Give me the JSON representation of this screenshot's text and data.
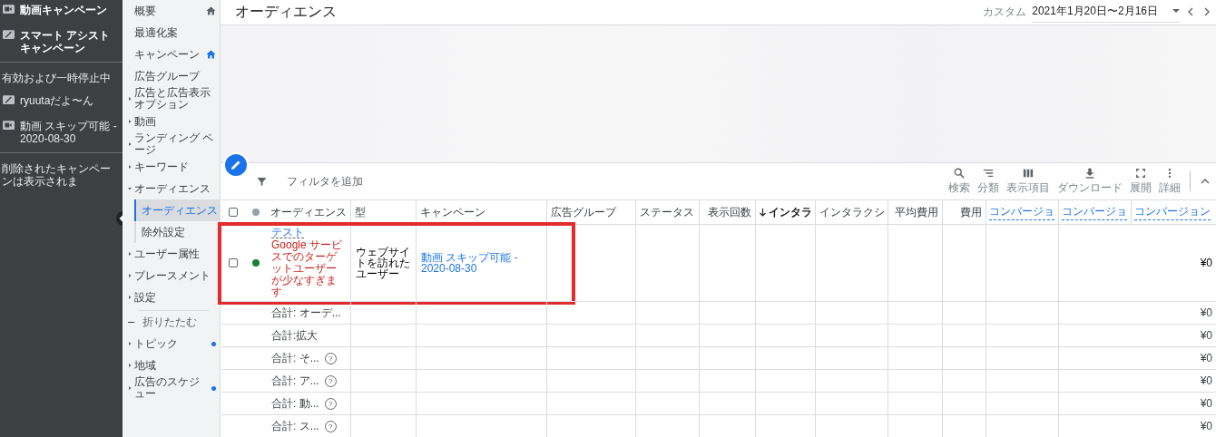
{
  "campaign_panel": {
    "campaigns": [
      {
        "kind": "video",
        "name": "動画キャンペーン"
      },
      {
        "kind": "smart",
        "name": "スマート アシストキャンペーン"
      }
    ],
    "section_label": "有効および一時停止中",
    "active_campaigns": [
      {
        "kind": "smart",
        "name": "ryuutaだよ〜ん"
      },
      {
        "kind": "video",
        "name": "動画 スキップ可能 - 2020-08-30"
      }
    ],
    "deleted_note": "削除されたキャンペーンは表示されま"
  },
  "nav": {
    "items": [
      {
        "kind": "link",
        "label": "概要",
        "selected": false,
        "home": true,
        "home_active": false
      },
      {
        "kind": "link",
        "label": "最適化案",
        "selected": false
      },
      {
        "kind": "link",
        "label": "キャンペーン",
        "selected": false,
        "home": true,
        "home_active": true
      },
      {
        "kind": "link",
        "label": "広告グループ",
        "selected": false
      },
      {
        "kind": "expandable",
        "label": "広告と広告表示オプション",
        "selected": false,
        "expanded": false
      },
      {
        "kind": "expandable",
        "label": "動画",
        "selected": false,
        "expanded": false
      },
      {
        "kind": "expandable",
        "label": "ランディング ページ",
        "selected": false,
        "expanded": false
      },
      {
        "kind": "expandable",
        "label": "キーワード",
        "selected": false,
        "expanded": false
      },
      {
        "kind": "expandable",
        "label": "オーディエンス",
        "selected": false,
        "expanded": true,
        "children": [
          {
            "label": "オーディエンス",
            "selected": true
          },
          {
            "label": "除外設定",
            "selected": false
          }
        ]
      },
      {
        "kind": "expandable",
        "label": "ユーザー属性",
        "selected": false,
        "expanded": false
      },
      {
        "kind": "expandable",
        "label": "プレースメント",
        "selected": false,
        "expanded": false
      },
      {
        "kind": "expandable",
        "label": "設定",
        "selected": false,
        "expanded": false
      },
      {
        "kind": "collapse",
        "label": "折りたたむ",
        "selected": false
      },
      {
        "kind": "expandable",
        "label": "トピック",
        "selected": false,
        "expanded": false,
        "dot": true
      },
      {
        "kind": "expandable",
        "label": "地域",
        "selected": false,
        "expanded": false
      },
      {
        "kind": "expandable",
        "label": "広告のスケジュー",
        "selected": false,
        "expanded": false,
        "dot": true
      }
    ]
  },
  "header": {
    "title": "オーディエンス",
    "date_label": "カスタム",
    "date_range": "2021年1月20日〜2月16日"
  },
  "toolbar": {
    "filter_placeholder": "フィルタを追加",
    "actions": [
      {
        "kind": "search",
        "label": "検索"
      },
      {
        "kind": "segment",
        "label": "分類"
      },
      {
        "kind": "columns",
        "label": "表示項目"
      },
      {
        "kind": "download",
        "label": "ダウンロード"
      },
      {
        "kind": "expand",
        "label": "展開"
      },
      {
        "kind": "more",
        "label": "詳細"
      }
    ]
  },
  "table": {
    "header_checked": false,
    "columns": [
      {
        "kind": "text",
        "label": "オーディエンス"
      },
      {
        "kind": "text",
        "label": "型"
      },
      {
        "kind": "text",
        "label": "キャンペーン"
      },
      {
        "kind": "text",
        "label": "広告グループ"
      },
      {
        "kind": "text",
        "label": "ステータス"
      },
      {
        "kind": "number",
        "label": "表示回数"
      },
      {
        "kind": "sorted",
        "label": "インタラ"
      },
      {
        "kind": "text",
        "label": "インタラクシ"
      },
      {
        "kind": "number",
        "label": "平均費用"
      },
      {
        "kind": "number",
        "label": "費用"
      },
      {
        "kind": "conversion",
        "label": "コンバージョ"
      },
      {
        "kind": "conversion",
        "label": "コンバージョ"
      },
      {
        "kind": "conversion",
        "label": "コンバージョン"
      }
    ],
    "rows": [
      {
        "kind": "entity",
        "checked": false,
        "highlighted": true,
        "color": "#188038",
        "audience": "テスト",
        "warning": "Google サービスでのターゲットユーザーが少なすぎます",
        "type": "ウェブサイトを訪れたユーザー",
        "campaign": "動画 スキップ可能 - 2020-08-30",
        "last": "¥0"
      },
      {
        "kind": "total",
        "label": "合計: オーデ...",
        "last": "¥0"
      },
      {
        "kind": "total",
        "label": "合計:拡大",
        "last": "¥0"
      },
      {
        "kind": "total",
        "label": "合計: そ...",
        "help": "?",
        "last": "¥0"
      },
      {
        "kind": "total",
        "label": "合計: ア...",
        "help": "?",
        "last": "¥0"
      },
      {
        "kind": "total",
        "label": "合計: 動...",
        "help": "?",
        "last": "¥0"
      },
      {
        "kind": "total",
        "label": "合計: ス...",
        "help": "?",
        "last": "¥0"
      }
    ]
  }
}
